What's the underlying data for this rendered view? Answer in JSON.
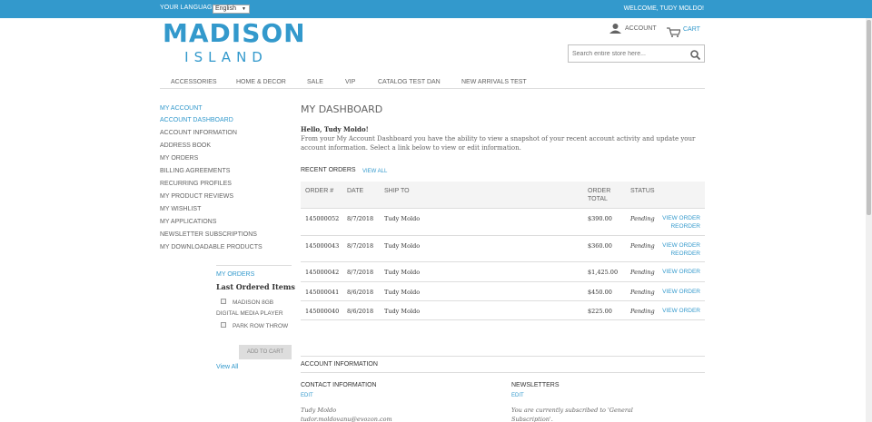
{
  "topbar": {
    "language_label": "YOUR LANGUAGE:",
    "language_value": "English",
    "welcome": "WELCOME, TUDY MOLDO!"
  },
  "logo": {
    "main": "MADISON",
    "sub": "ISLAND"
  },
  "header": {
    "account_label": "ACCOUNT",
    "cart_label": "CART",
    "search_placeholder": "Search entire store here..."
  },
  "nav": [
    "ACCESSORIES",
    "HOME & DECOR",
    "SALE",
    "VIP",
    "CATALOG TEST DAN",
    "NEW ARRIVALS TEST"
  ],
  "sidebar": {
    "title": "MY ACCOUNT",
    "items": [
      {
        "label": "ACCOUNT DASHBOARD",
        "active": true
      },
      {
        "label": "ACCOUNT INFORMATION"
      },
      {
        "label": "ADDRESS BOOK"
      },
      {
        "label": "MY ORDERS"
      },
      {
        "label": "BILLING AGREEMENTS"
      },
      {
        "label": "RECURRING PROFILES"
      },
      {
        "label": "MY PRODUCT REVIEWS"
      },
      {
        "label": "MY WISHLIST"
      },
      {
        "label": "MY APPLICATIONS"
      },
      {
        "label": "NEWSLETTER SUBSCRIPTIONS"
      },
      {
        "label": "MY DOWNLOADABLE PRODUCTS"
      }
    ]
  },
  "mini_orders": {
    "title": "MY ORDERS",
    "subtitle": "Last Ordered Items",
    "items": [
      "MADISON 8GB DIGITAL MEDIA PLAYER",
      "PARK ROW THROW"
    ],
    "add_to_cart": "ADD TO CART",
    "view_all": "View All"
  },
  "main": {
    "title": "MY DASHBOARD",
    "hello": "Hello, Tudy Moldo!",
    "intro": "From your My Account Dashboard you have the ability to view a snapshot of your recent account activity and update your account information. Select a link below to view or edit information."
  },
  "recent_orders": {
    "title": "RECENT ORDERS",
    "view_all": "VIEW ALL",
    "headers": [
      "ORDER #",
      "DATE",
      "SHIP TO",
      "ORDER TOTAL",
      "STATUS"
    ],
    "rows": [
      {
        "order": "145000052",
        "date": "8/7/2018",
        "ship_to": "Tudy Moldo",
        "total": "$390.00",
        "status": "Pending",
        "view": "VIEW ORDER",
        "reorder": "REORDER"
      },
      {
        "order": "145000043",
        "date": "8/7/2018",
        "ship_to": "Tudy Moldo",
        "total": "$360.00",
        "status": "Pending",
        "view": "VIEW ORDER",
        "reorder": "REORDER"
      },
      {
        "order": "145000042",
        "date": "8/7/2018",
        "ship_to": "Tudy Moldo",
        "total": "$1,425.00",
        "status": "Pending",
        "view": "VIEW ORDER"
      },
      {
        "order": "145000041",
        "date": "8/6/2018",
        "ship_to": "Tudy Moldo",
        "total": "$450.00",
        "status": "Pending",
        "view": "VIEW ORDER"
      },
      {
        "order": "145000040",
        "date": "8/6/2018",
        "ship_to": "Tudy Moldo",
        "total": "$225.00",
        "status": "Pending",
        "view": "VIEW ORDER"
      }
    ]
  },
  "account_info": {
    "title": "ACCOUNT INFORMATION",
    "contact_title": "CONTACT INFORMATION",
    "contact_edit": "EDIT",
    "contact_name": "Tudy Moldo",
    "contact_email": "tudor.moldovanu@evozon.com",
    "newsletters_title": "NEWSLETTERS",
    "newsletters_edit": "EDIT",
    "newsletters_text": "You are currently subscribed to 'General Subscription'."
  },
  "colors": {
    "accent": "#3399cc",
    "text": "#636363"
  }
}
